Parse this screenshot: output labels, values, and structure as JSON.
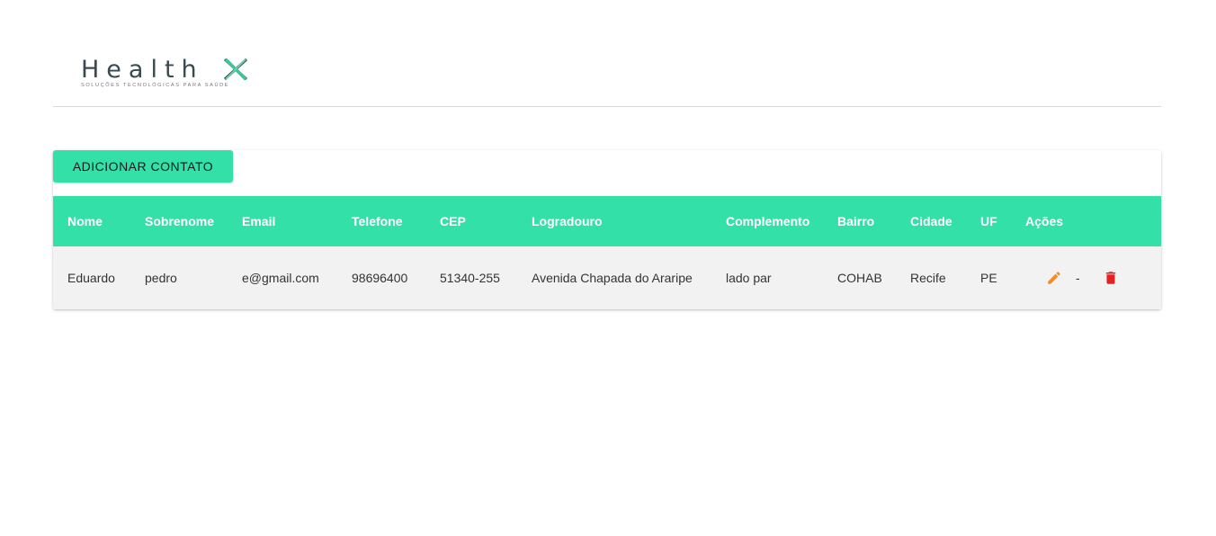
{
  "brand": {
    "name": "Health",
    "tagline": "Soluções Tecnológicas para Saúde",
    "primary_color": "#33e0a8"
  },
  "toolbar": {
    "add_label": "ADICIONAR CONTATO"
  },
  "table": {
    "headers": [
      "Nome",
      "Sobrenome",
      "Email",
      "Telefone",
      "CEP",
      "Logradouro",
      "Complemento",
      "Bairro",
      "Cidade",
      "UF",
      "Ações"
    ],
    "rows": [
      {
        "nome": "Eduardo",
        "sobrenome": "pedro",
        "email": "e@gmail.com",
        "telefone": "98696400",
        "cep": "51340-255",
        "logradouro": "Avenida Chapada do Araripe",
        "complemento": "lado par",
        "bairro": "COHAB",
        "cidade": "Recife",
        "uf": "PE",
        "separator": "-"
      }
    ]
  },
  "icons": {
    "edit": "pencil-icon",
    "delete": "trash-icon",
    "edit_color": "#f28c28",
    "delete_color": "#e52222"
  }
}
